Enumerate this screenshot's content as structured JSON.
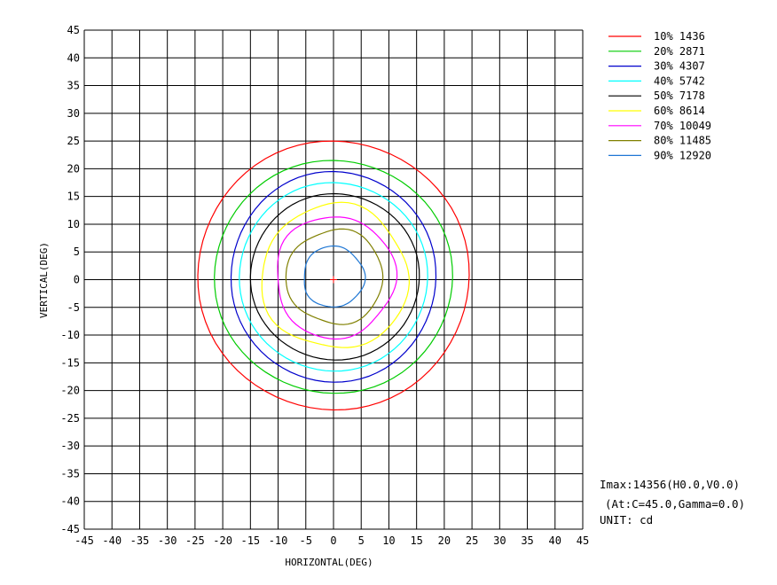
{
  "chart_data": {
    "type": "contour",
    "xlabel": "HORIZONTAL(DEG)",
    "ylabel": "VERTICAL(DEG)",
    "xlim": [
      -45,
      45
    ],
    "ylim": [
      -45,
      45
    ],
    "x_ticks": [
      "-45",
      "-40",
      "-35",
      "-30",
      "-25",
      "-20",
      "-15",
      "-10",
      "-5",
      "0",
      "5",
      "10",
      "15",
      "20",
      "25",
      "30",
      "35",
      "40",
      "45"
    ],
    "y_ticks": [
      "45",
      "40",
      "35",
      "30",
      "25",
      "20",
      "15",
      "10",
      "5",
      "0",
      "-5",
      "-10",
      "-15",
      "-20",
      "-25",
      "-30",
      "-35",
      "-40",
      "-45"
    ],
    "grid": true,
    "legend_position": "top-right",
    "center_marker": {
      "x": 0,
      "y": 0,
      "color": "#ff0000"
    },
    "series": [
      {
        "name": "10% 1436",
        "percent": 10,
        "value": 1436,
        "color": "#ff0000",
        "extent": {
          "x": [
            -24.5,
            24.5
          ],
          "y": [
            -23.5,
            25
          ]
        }
      },
      {
        "name": "20% 2871",
        "percent": 20,
        "value": 2871,
        "color": "#00cc00",
        "extent": {
          "x": [
            -21.5,
            21.5
          ],
          "y": [
            -20.5,
            21.5
          ]
        }
      },
      {
        "name": "30% 4307",
        "percent": 30,
        "value": 4307,
        "color": "#0000cc",
        "extent": {
          "x": [
            -18.5,
            18.5
          ],
          "y": [
            -18.5,
            19.5
          ]
        }
      },
      {
        "name": "40% 5742",
        "percent": 40,
        "value": 5742,
        "color": "#00ffff",
        "extent": {
          "x": [
            -17,
            17
          ],
          "y": [
            -16.5,
            17.5
          ]
        }
      },
      {
        "name": "50% 7178",
        "percent": 50,
        "value": 7178,
        "color": "#000000",
        "extent": {
          "x": [
            -15,
            15.5
          ],
          "y": [
            -14.5,
            15.5
          ]
        }
      },
      {
        "name": "60% 8614",
        "percent": 60,
        "value": 8614,
        "color": "#ffff00",
        "extent": {
          "x": [
            -13,
            13.5
          ],
          "y": [
            -12.5,
            13.5
          ]
        }
      },
      {
        "name": "70% 10049",
        "percent": 70,
        "value": 10049,
        "color": "#ff00ff",
        "extent": {
          "x": [
            -10.5,
            11
          ],
          "y": [
            -10.5,
            11.5
          ]
        }
      },
      {
        "name": "80% 11485",
        "percent": 80,
        "value": 11485,
        "color": "#808000",
        "extent": {
          "x": [
            -8.5,
            9
          ],
          "y": [
            -8,
            9
          ]
        }
      },
      {
        "name": "90% 12920",
        "percent": 90,
        "value": 12920,
        "color": "#1f77d4",
        "extent": {
          "x": [
            -5.5,
            5.5
          ],
          "y": [
            -5,
            6
          ]
        }
      }
    ]
  },
  "info": {
    "imax": "Imax:14356(H0.0,V0.0)",
    "at": "(At:C=45.0,Gamma=0.0)",
    "unit": "UNIT: cd"
  }
}
